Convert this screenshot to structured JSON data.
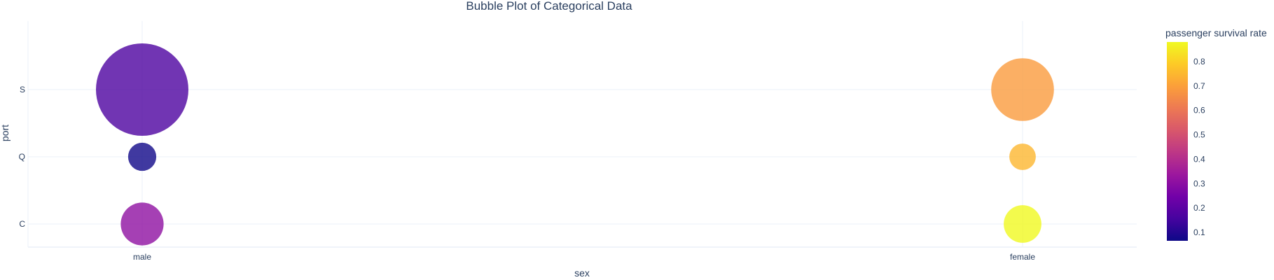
{
  "chart_data": {
    "type": "scatter",
    "title": "Bubble Plot of Categorical Data",
    "xlabel": "sex",
    "ylabel": "port",
    "x_categories": [
      "male",
      "female"
    ],
    "y_categories": [
      "C",
      "Q",
      "S"
    ],
    "points": [
      {
        "x": "male",
        "y": "S",
        "size": 441,
        "survival_rate": 0.17
      },
      {
        "x": "male",
        "y": "Q",
        "size": 41,
        "survival_rate": 0.07
      },
      {
        "x": "male",
        "y": "C",
        "size": 95,
        "survival_rate": 0.31
      },
      {
        "x": "female",
        "y": "S",
        "size": 203,
        "survival_rate": 0.69
      },
      {
        "x": "female",
        "y": "Q",
        "size": 36,
        "survival_rate": 0.75
      },
      {
        "x": "female",
        "y": "C",
        "size": 73,
        "survival_rate": 0.88
      }
    ],
    "colorbar": {
      "title": "passenger survival rate",
      "range": [
        0.066,
        0.88
      ],
      "ticks": [
        0.1,
        0.2,
        0.3,
        0.4,
        0.5,
        0.6,
        0.7,
        0.8
      ],
      "colorscale": [
        "#0d0887",
        "#46039f",
        "#7201a8",
        "#9c179e",
        "#bd3786",
        "#d8576b",
        "#ed7953",
        "#fb9f3a",
        "#fdca26",
        "#f0f921"
      ]
    },
    "grid": true,
    "legend": "colorbar-right"
  }
}
